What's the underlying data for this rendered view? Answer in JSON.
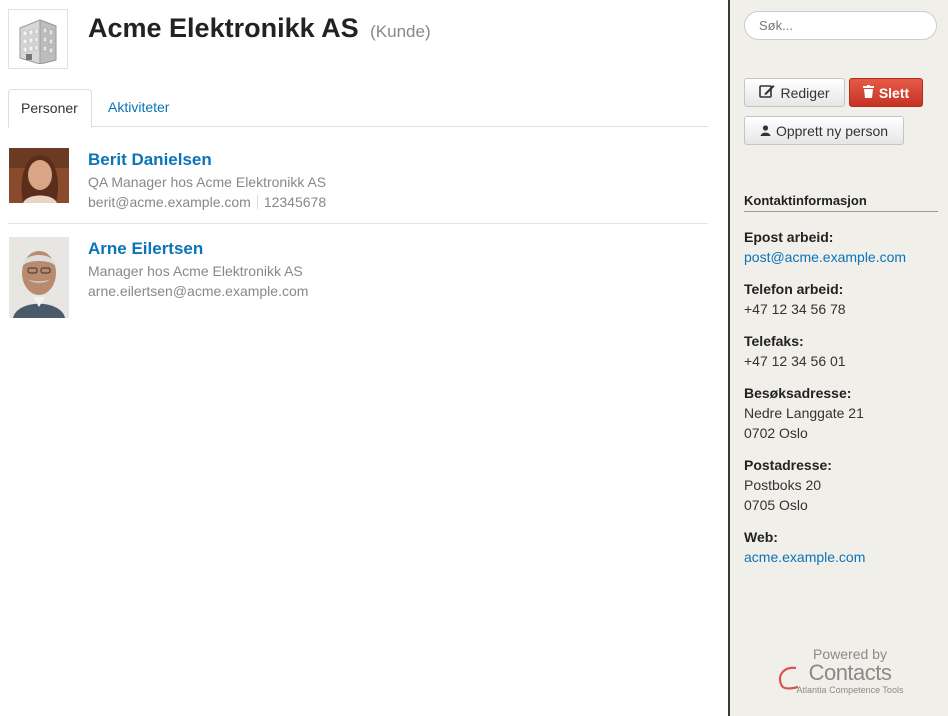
{
  "header": {
    "company_name": "Acme Elektronikk AS",
    "company_type": "(Kunde)",
    "logo_icon": "building-icon"
  },
  "tabs": [
    {
      "label": "Personer",
      "active": true
    },
    {
      "label": "Aktiviteter",
      "active": false
    }
  ],
  "persons": [
    {
      "name": "Berit Danielsen",
      "title": "QA Manager hos Acme Elektronikk AS",
      "email": "berit@acme.example.com",
      "phone": "12345678"
    },
    {
      "name": "Arne Eilertsen",
      "title": "Manager hos Acme Elektronikk AS",
      "email": "arne.eilertsen@acme.example.com"
    }
  ],
  "sidebar": {
    "search": {
      "placeholder": "Søk..."
    },
    "edit_label": "Rediger",
    "delete_label": "Slett",
    "new_person_label": "Opprett ny person",
    "contact_heading": "Kontaktinformasjon",
    "contact": {
      "work_email_label": "Epost arbeid:",
      "work_email": "post@acme.example.com",
      "work_phone_label": "Telefon arbeid:",
      "work_phone": "+47 12 34 56 78",
      "fax_label": "Telefaks:",
      "fax": "+47 12 34 56 01",
      "visit_address_label": "Besøksadresse:",
      "visit_address_line1": "Nedre Langgate 21",
      "visit_address_line2": "0702 Oslo",
      "postal_address_label": "Postadresse:",
      "postal_address_line1": "Postboks 20",
      "postal_address_line2": "0705 Oslo",
      "web_label": "Web:",
      "web": "acme.example.com"
    },
    "footer": {
      "powered_by": "Powered by",
      "brand": "Contacts",
      "tagline": "Atlantia Competence Tools"
    }
  },
  "colors": {
    "link": "#0a74b8",
    "danger": "#d33b28",
    "sidebar_bg": "#f1efea"
  }
}
